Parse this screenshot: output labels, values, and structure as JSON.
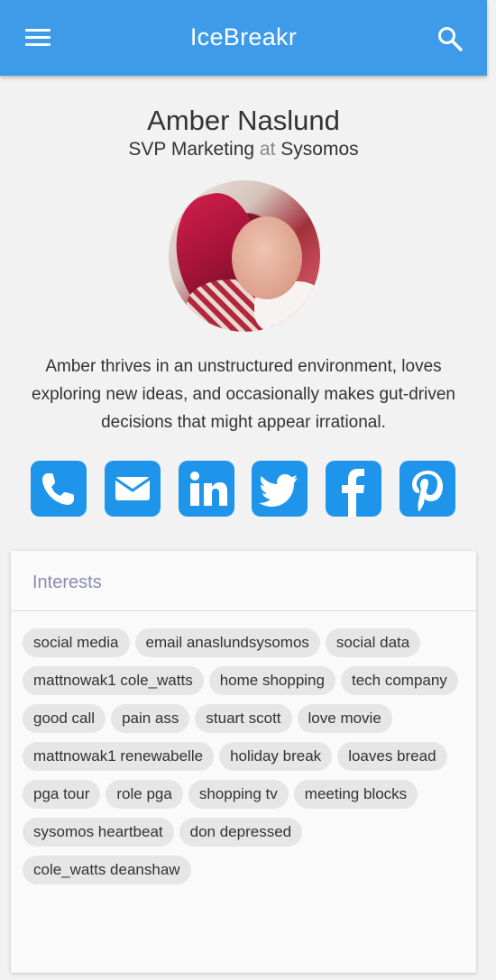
{
  "app_bar": {
    "title": "IceBreakr"
  },
  "profile": {
    "name": "Amber Naslund",
    "title": "SVP Marketing",
    "at": "at",
    "company": "Sysomos",
    "bio": "Amber thrives in an unstructured environment, loves exploring new ideas, and occasionally makes gut-driven decisions that might appear irrational."
  },
  "social_icons": [
    "phone-icon",
    "email-icon",
    "linkedin-icon",
    "twitter-icon",
    "facebook-icon",
    "pinterest-icon"
  ],
  "colors": {
    "app_bar": "#3d9be9",
    "social": "#1e95ea",
    "chip": "#e6e6e6",
    "card_title": "#8c8cad"
  },
  "interests": {
    "title": "Interests",
    "chips": [
      "social media",
      "email anaslundsysomos",
      "social data",
      "mattnowak1 cole_watts",
      "home shopping",
      "tech company",
      "good call",
      "pain ass",
      "stuart scott",
      "love movie",
      "mattnowak1 renewabelle",
      "holiday break",
      "loaves bread",
      "pga tour",
      "role pga",
      "shopping tv",
      "meeting blocks",
      "sysomos heartbeat",
      "don depressed",
      "cole_watts deanshaw"
    ]
  }
}
